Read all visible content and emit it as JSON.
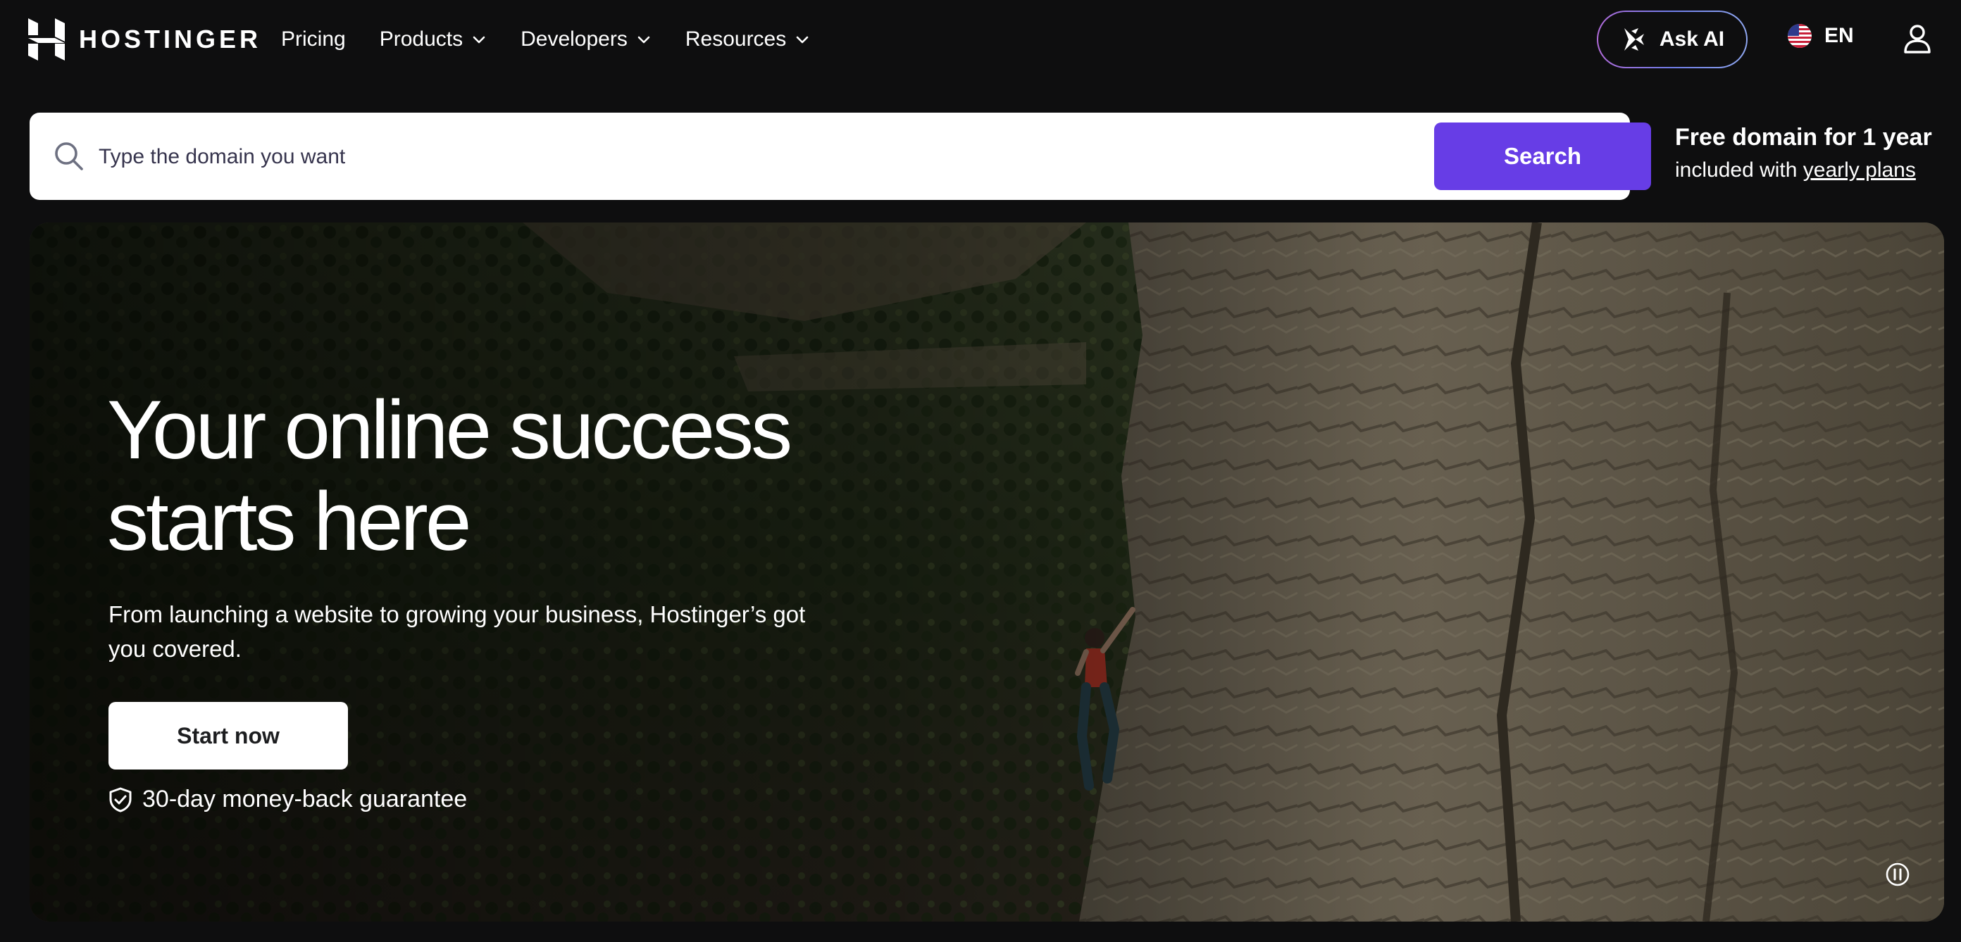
{
  "brand": {
    "name": "HOSTINGER"
  },
  "nav": {
    "items": [
      {
        "label": "Pricing",
        "has_dropdown": false
      },
      {
        "label": "Products",
        "has_dropdown": true
      },
      {
        "label": "Developers",
        "has_dropdown": true
      },
      {
        "label": "Resources",
        "has_dropdown": true
      }
    ],
    "ask_ai_label": "Ask AI",
    "language_label": "EN"
  },
  "search": {
    "placeholder": "Type the domain you want",
    "value": "",
    "button_label": "Search"
  },
  "promo": {
    "title": "Free domain for 1 year",
    "prefix": "included with ",
    "link_text": "yearly plans"
  },
  "hero": {
    "title_line1": "Your online success",
    "title_line2": "starts here",
    "subtitle": "From launching a website to growing your business, Hostinger’s got you covered.",
    "cta_label": "Start now",
    "guarantee": "30-day money-back guarantee"
  },
  "colors": {
    "page_background": "#0e0e0f",
    "accent": "#673de6",
    "search_background": "#ffffff"
  },
  "icons": [
    "hostinger-logo",
    "chevron-down-icon",
    "ai-sparkle-icon",
    "us-flag-icon",
    "user-icon",
    "search-icon",
    "shield-check-icon",
    "pause-icon"
  ]
}
